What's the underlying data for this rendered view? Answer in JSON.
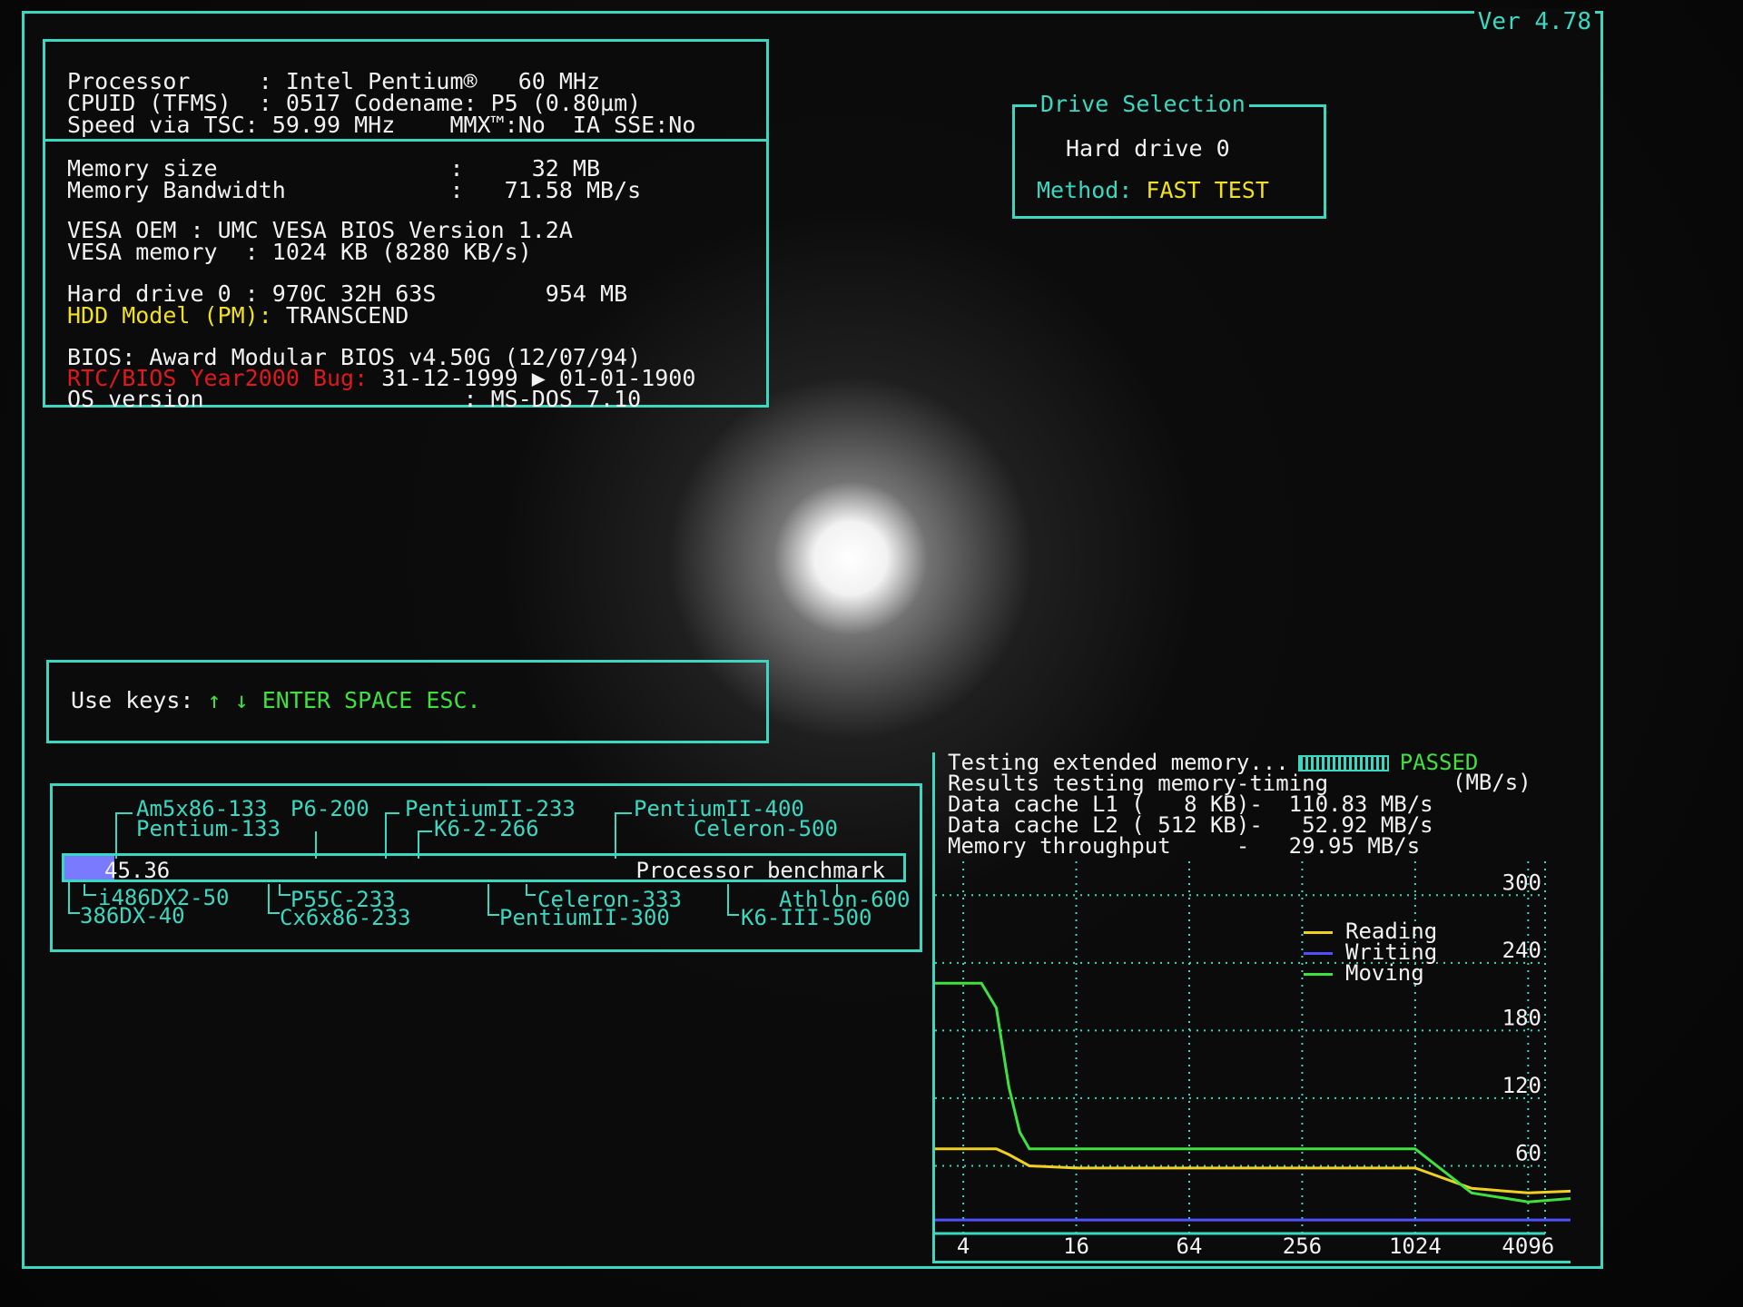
{
  "version": "Ver 4.78",
  "sysinfo": {
    "proc_label": "Processor",
    "proc_value": ": Intel Pentium®   60 MHz",
    "cpuid_label": "CPUID (TFMS)",
    "cpuid_value": ": 0517 Codename: P5 (0.80µm)",
    "speed_label": "Speed via TSC:",
    "speed_value": "59.99 MHz    MMX™:No  IA SSE:No",
    "memsize_label": "Memory size",
    "memsize_value": ":     32 MB",
    "membw_label": "Memory Bandwidth",
    "membw_value": ":   71.58 MB/s",
    "vesa_oem": "VESA OEM : UMC VESA BIOS Version 1.2A",
    "vesa_mem": "VESA memory  : 1024 KB (8280 KB/s)",
    "hdd_label": "Hard drive 0 :",
    "hdd_value": "970C 32H 63S        954 MB",
    "hdd_model_label": "HDD Model (PM):",
    "hdd_model_value": "TRANSCEND",
    "bios": "BIOS: Award Modular BIOS v4.50G (12/07/94)",
    "rtc_label": "RTC/BIOS Year2000 Bug:",
    "rtc_value": "31-12-1999 ▶ 01-01-1900",
    "os_label": "OS version",
    "os_value": ": MS-DOS 7.10"
  },
  "drive": {
    "title": "Drive Selection",
    "drive": "Hard drive 0",
    "method_label": "Method:",
    "method_value": "FAST TEST"
  },
  "keys": {
    "label": "Use keys:",
    "keys": "↑ ↓ ENTER SPACE ESC."
  },
  "bench": {
    "score": "45.36",
    "label": "Processor benchmark",
    "score_fraction": 0.06,
    "upper": [
      "Am5x86-133",
      "Pentium-133",
      "P6-200",
      "PentiumII-233",
      "K6-2-266",
      "PentiumII-400",
      "Celeron-500"
    ],
    "lower": [
      "i486DX2-50",
      "386DX-40",
      "P55C-233",
      "Cx6x86-233",
      "Celeron-333",
      "PentiumII-300",
      "Athlon-600",
      "K6-III-500"
    ]
  },
  "memtest": {
    "ext_label": "Testing extended memory...",
    "ext_status": "PASSED",
    "results_label": "Results testing memory-timing",
    "units": "(MB/s)",
    "l1": "Data cache L1 (   8 KB)-  110.83 MB/s",
    "l2": "Data cache L2 ( 512 KB)-   52.92 MB/s",
    "mem": "Memory throughput     -   29.95 MB/s"
  },
  "colors": {
    "frame": "#3ad8c0",
    "reading": "#f0d020",
    "writing": "#5050ff",
    "moving": "#40e040"
  },
  "chart_data": {
    "type": "line",
    "x_ticks": [
      "4",
      "16",
      "64",
      "256",
      "1024",
      "4096"
    ],
    "y_ticks": [
      "60",
      "120",
      "180",
      "240",
      "300"
    ],
    "ylim": [
      0,
      330
    ],
    "x_log2_range": [
      1.5,
      12.3
    ],
    "legend_position": "right",
    "grid": true,
    "series": [
      {
        "name": "Reading",
        "color": "#f0d020",
        "x": [
          2,
          4,
          6,
          7,
          9,
          16,
          32,
          64,
          256,
          512,
          768,
          1024,
          2048,
          4096,
          8192
        ],
        "values": [
          75,
          75,
          75,
          70,
          60,
          58,
          58,
          58,
          58,
          58,
          58,
          58,
          40,
          36,
          38
        ]
      },
      {
        "name": "Writing",
        "color": "#5050ff",
        "x": [
          2,
          4,
          16,
          64,
          256,
          1024,
          2048,
          4096,
          8192
        ],
        "values": [
          12,
          12,
          12,
          12,
          12,
          12,
          12,
          12,
          12
        ]
      },
      {
        "name": "Moving",
        "color": "#40e040",
        "x": [
          2,
          4,
          5,
          6,
          7,
          8,
          9,
          16,
          64,
          256,
          768,
          1024,
          2048,
          4096,
          8192
        ],
        "values": [
          222,
          222,
          222,
          200,
          130,
          90,
          75,
          75,
          75,
          75,
          75,
          75,
          36,
          28,
          32
        ]
      }
    ]
  }
}
